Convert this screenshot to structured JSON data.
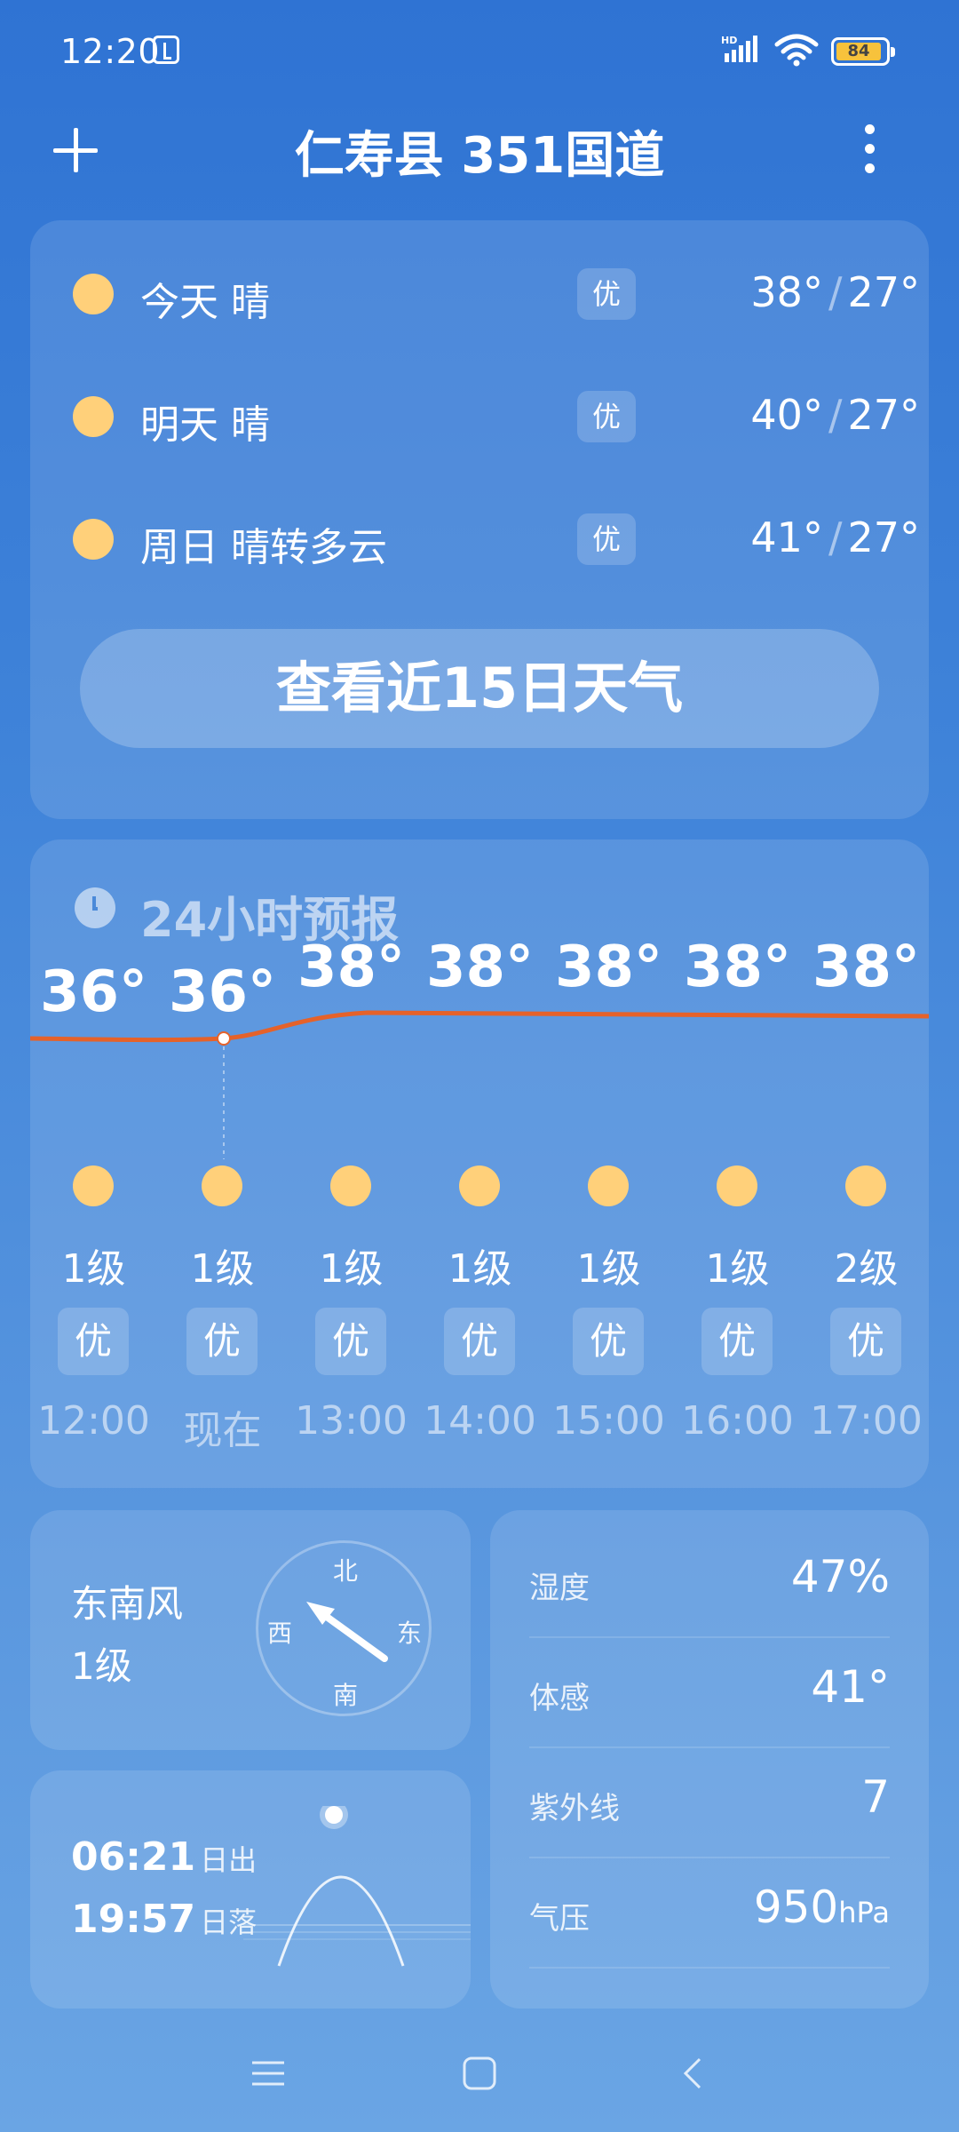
{
  "status": {
    "time": "12:20",
    "battery": "84"
  },
  "header": {
    "title": "仁寿县 351国道"
  },
  "daily": [
    {
      "day": "今天  晴",
      "aqi": "优",
      "high": "38°",
      "low": "27°"
    },
    {
      "day": "明天  晴",
      "aqi": "优",
      "high": "40°",
      "low": "27°"
    },
    {
      "day": "周日  晴转多云",
      "aqi": "优",
      "high": "41°",
      "low": "27°"
    }
  ],
  "daily_button": "查看近15日天气",
  "hourly": {
    "title": "24小时预报",
    "items": [
      {
        "temp": "36°",
        "wind": "1级",
        "aqi": "优",
        "time": "12:00"
      },
      {
        "temp": "36°",
        "wind": "1级",
        "aqi": "优",
        "time": "现在"
      },
      {
        "temp": "38°",
        "wind": "1级",
        "aqi": "优",
        "time": "13:00"
      },
      {
        "temp": "38°",
        "wind": "1级",
        "aqi": "优",
        "time": "14:00"
      },
      {
        "temp": "38°",
        "wind": "1级",
        "aqi": "优",
        "time": "15:00"
      },
      {
        "temp": "38°",
        "wind": "1级",
        "aqi": "优",
        "time": "16:00"
      },
      {
        "temp": "38°",
        "wind": "2级",
        "aqi": "优",
        "time": "17:00"
      }
    ]
  },
  "wind": {
    "direction": "东南风",
    "level": "1级",
    "compass": {
      "n": "北",
      "s": "南",
      "e": "东",
      "w": "西"
    }
  },
  "sun": {
    "sunrise": "06:21",
    "sunrise_label": "日出",
    "sunset": "19:57",
    "sunset_label": "日落"
  },
  "details": [
    {
      "label": "湿度",
      "value": "47%",
      "unit": ""
    },
    {
      "label": "体感",
      "value": "41°",
      "unit": ""
    },
    {
      "label": "紫外线",
      "value": "7",
      "unit": ""
    },
    {
      "label": "气压",
      "value": "950",
      "unit": "hPa"
    }
  ],
  "colors": {
    "sun": "#ffd07a",
    "temp_line": "#e5622a",
    "battery": "#f7c23c"
  }
}
